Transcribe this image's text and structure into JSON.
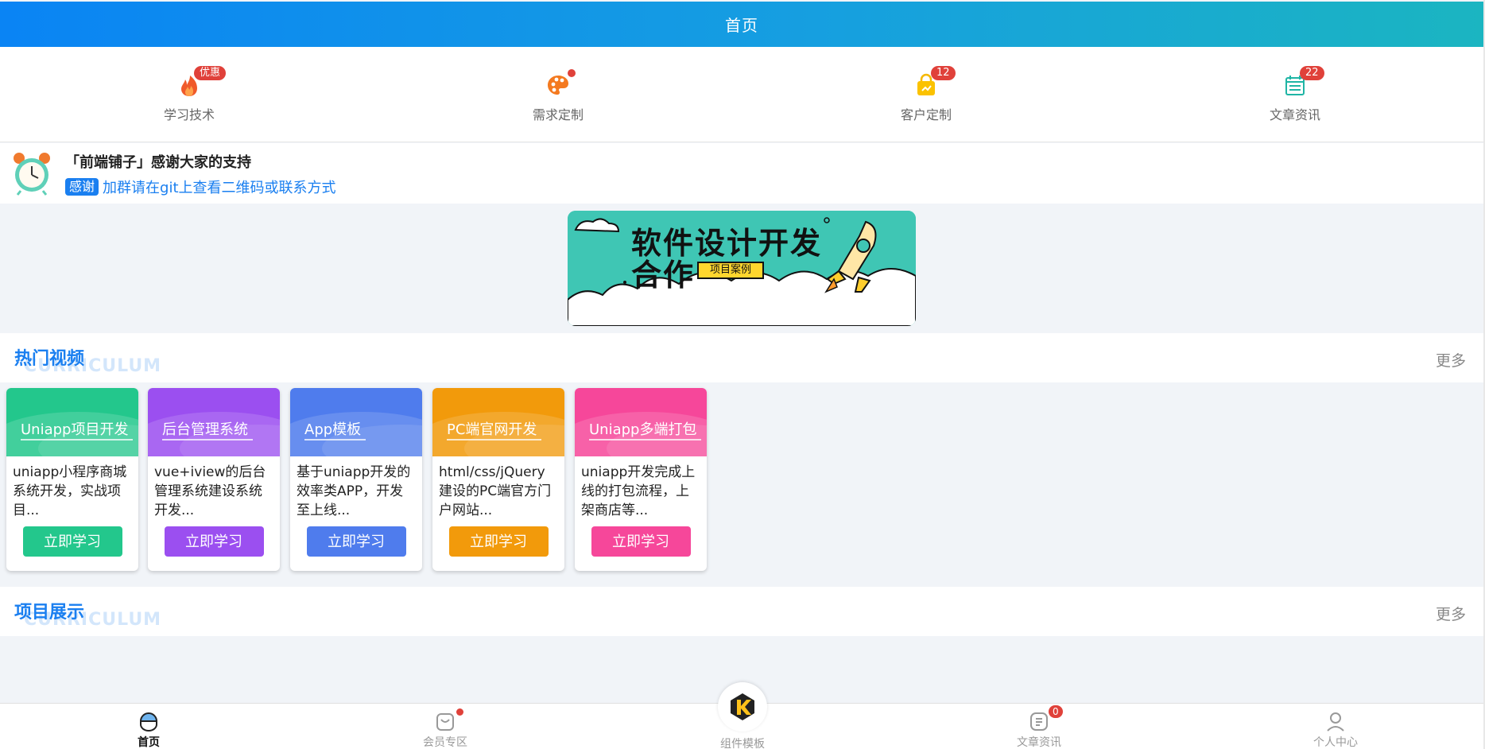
{
  "header": {
    "title": "首页"
  },
  "quick_nav": [
    {
      "label": "学习技术",
      "badge": "优惠",
      "icon": "fire-icon"
    },
    {
      "label": "需求定制",
      "dot": true,
      "icon": "palette-icon"
    },
    {
      "label": "客户定制",
      "badge": "12",
      "icon": "shopping-bag-icon"
    },
    {
      "label": "文章资讯",
      "badge": "22",
      "icon": "calendar-list-icon"
    }
  ],
  "notice": {
    "title": "「前端铺子」感谢大家的支持",
    "tag": "感谢",
    "text": "加群请在git上查看二维码或联系方式",
    "icon": "alarm-clock-icon"
  },
  "banner": {
    "title_line1": "软件设计开发",
    "title_line2": "合作",
    "tag": "项目案例",
    "icon": "rocket-icon"
  },
  "hot_videos": {
    "title": "热门视频",
    "bg_text": "CURRICULUM",
    "more": "更多",
    "cards": [
      {
        "title": "Uniapp项目开发",
        "desc": "uniapp小程序商城系统开发，实战项目...",
        "button": "立即学习",
        "color": "#23c78c"
      },
      {
        "title": "后台管理系统",
        "desc": "vue+iview的后台管理系统建设系统开发...",
        "button": "立即学习",
        "color": "#9b4ff0"
      },
      {
        "title": "App模板",
        "desc": "基于uniapp开发的效率类APP，开发至上线...",
        "button": "立即学习",
        "color": "#4f7ced"
      },
      {
        "title": "PC端官网开发",
        "desc": "html/css/jQuery建设的PC端官方门户网站...",
        "button": "立即学习",
        "color": "#f29a0b"
      },
      {
        "title": "Uniapp多端打包",
        "desc": "uniapp开发完成上线的打包流程，上架商店等...",
        "button": "立即学习",
        "color": "#f6479a"
      }
    ]
  },
  "projects": {
    "title": "项目展示",
    "bg_text": "CURRICULUM",
    "more": "更多"
  },
  "tab_bar": {
    "items": [
      {
        "label": "首页",
        "active": true,
        "icon": "home-icon"
      },
      {
        "label": "会员专区",
        "dot": true,
        "icon": "member-bag-icon"
      },
      {
        "label": "组件模板",
        "icon": "k-logo-icon"
      },
      {
        "label": "文章资讯",
        "badge": "0",
        "icon": "article-icon"
      },
      {
        "label": "个人中心",
        "icon": "user-icon"
      }
    ]
  }
}
